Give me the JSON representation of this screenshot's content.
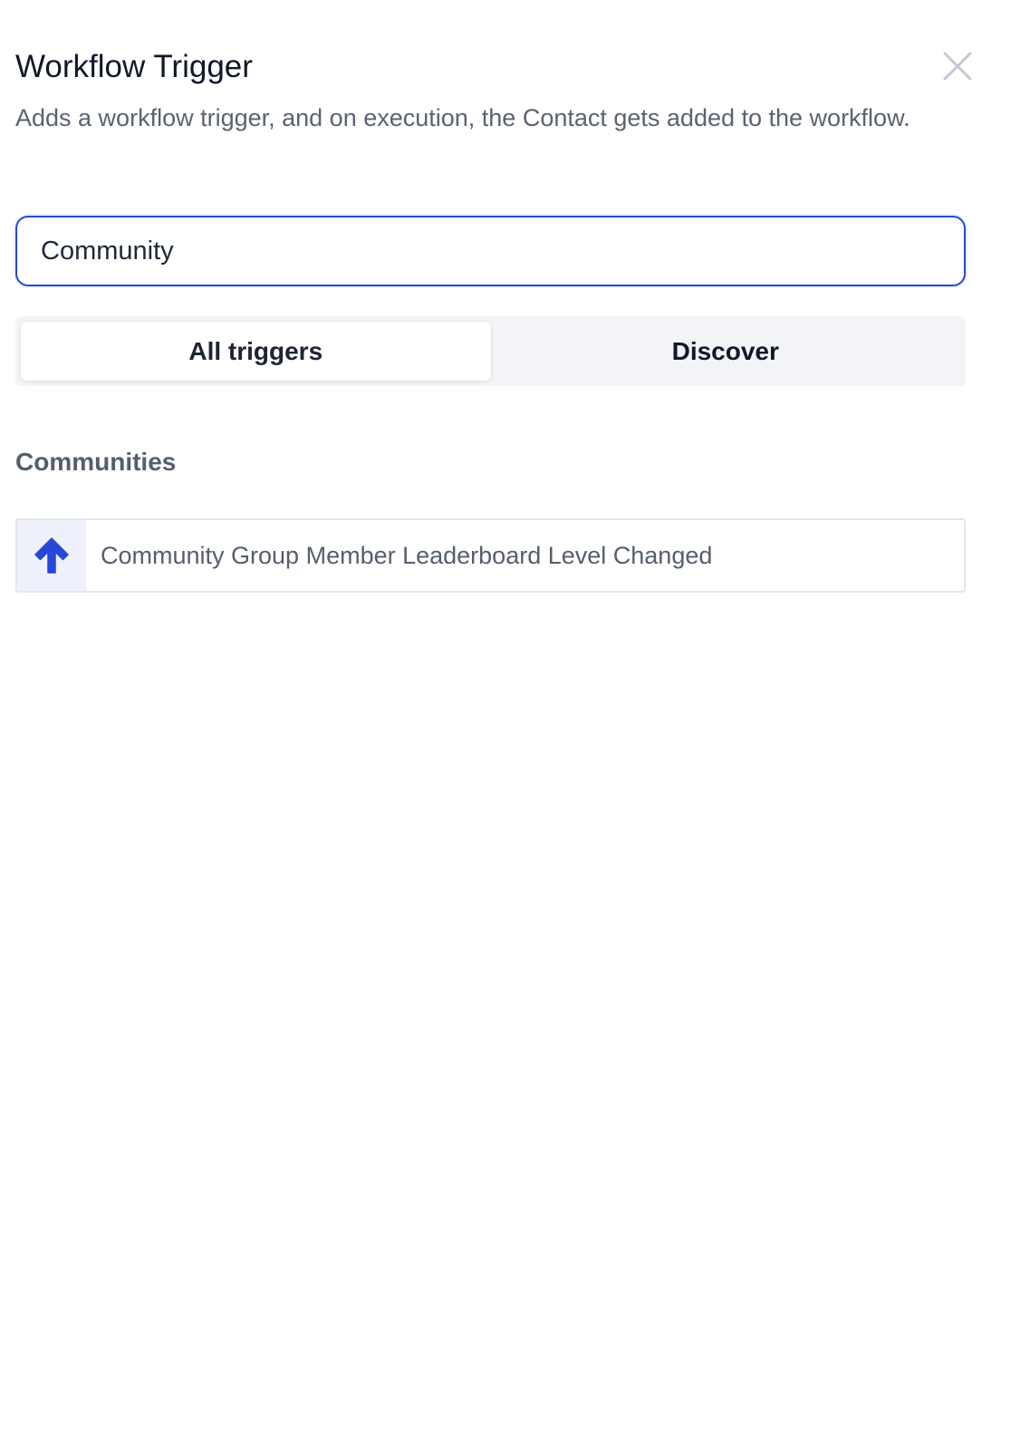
{
  "dialog": {
    "title": "Workflow Trigger",
    "description": "Adds a workflow trigger, and on execution, the Contact gets added to the workflow.",
    "close_icon": "close-icon"
  },
  "search": {
    "value": "Community",
    "placeholder": ""
  },
  "tabs": [
    {
      "label": "All triggers",
      "active": true
    },
    {
      "label": "Discover",
      "active": false
    }
  ],
  "sections": [
    {
      "heading": "Communities",
      "items": [
        {
          "icon": "arrow-up-icon",
          "label": "Community Group Member Leaderboard Level Changed"
        }
      ]
    }
  ],
  "colors": {
    "accent": "#2549d6",
    "icon_bg": "#eef1fb",
    "text_muted": "#555e6c"
  }
}
